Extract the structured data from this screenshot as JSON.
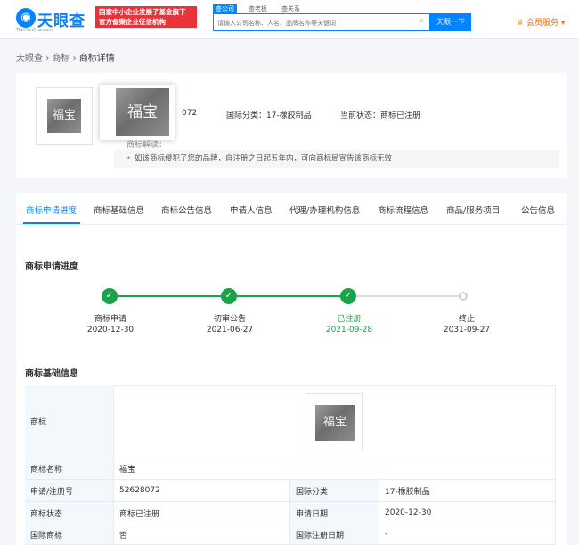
{
  "header": {
    "logo_text": "天眼查",
    "logo_sub": "TianYanCha.com",
    "banner_line1": "国家中小企业发展子基金旗下",
    "banner_line2": "官方备案企业征信机构",
    "search_tabs": [
      "查公司",
      "查老板",
      "查关系"
    ],
    "search_placeholder": "请输入公司名称、人名、品牌名称等关键词",
    "search_button": "天眼一下",
    "member_label": "会员服务",
    "accent_color": "#0084ff"
  },
  "breadcrumb": [
    "天眼查",
    "商标",
    "商标详情"
  ],
  "info": {
    "reg_no_partial": "072",
    "class_text": "国际分类：17-橡胶制品",
    "status_text": "当前状态：商标已注册",
    "note_title": "商标解读：",
    "note_text": "如该商标侵犯了您的品牌，自注册之日起五年内，可向商标局宣告该商标无效"
  },
  "tabs": [
    "商标申请进度",
    "商标基础信息",
    "商标公告信息",
    "申请人信息",
    "代理/办理机构信息",
    "商标流程信息",
    "商品/服务项目",
    "公告信息"
  ],
  "progress": {
    "title": "商标申请进度",
    "steps": [
      {
        "label": "商标申请",
        "date": "2020-12-30",
        "done": true
      },
      {
        "label": "初审公告",
        "date": "2021-06-27",
        "done": true
      },
      {
        "label": "已注册",
        "date": "2021-09-28",
        "done": true
      },
      {
        "label": "终止",
        "date": "2031-09-27",
        "done": false
      }
    ],
    "done_color": "#1aa34a"
  },
  "basic": {
    "title": "商标基础信息",
    "trademark_label": "商标",
    "trademark_text": "福宝",
    "rows": [
      {
        "k1": "商标名称",
        "v1": "福宝"
      },
      {
        "k1": "申请/注册号",
        "v1": "52628072",
        "k2": "国际分类",
        "v2": "17-橡胶制品"
      },
      {
        "k1": "商标状态",
        "v1": "商标已注册",
        "k2": "申请日期",
        "v2": "2020-12-30"
      },
      {
        "k1": "国际商标",
        "v1": "否",
        "k2": "国际注册日期",
        "v2": "-"
      }
    ]
  }
}
